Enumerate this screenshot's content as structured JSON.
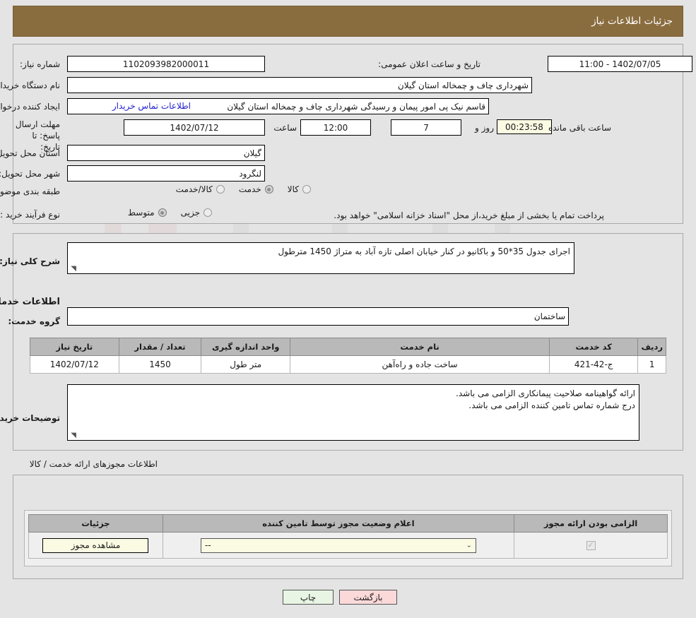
{
  "header": {
    "title": "جزئیات اطلاعات نیاز",
    "bar_color": "#8a6d3f"
  },
  "top_section": {
    "labels": {
      "need_number": "شماره نیاز:",
      "buyer_org": "نام دستگاه خریدار:",
      "requester": "ایجاد کننده درخواست:",
      "deadline": "مهلت ارسال پاسخ: تا تاریخ:",
      "province": "استان محل تحویل:",
      "city": "شهر محل تحویل:",
      "category": "طبقه بندی موضوعی:",
      "purchase_type": "نوع فرآیند خرید :",
      "public_announce": "تاریخ و ساعت اعلان عمومی:",
      "hour": "ساعت",
      "day_and": "روز و",
      "hours_left": "ساعت باقی مانده"
    },
    "values": {
      "need_number": "1102093982000011",
      "public_announce": "1402/07/05 - 11:00",
      "buyer_org": "شهرداری چاف و چمخاله استان گیلان",
      "requester": "قاسم نیک پی امور پیمان و رسیدگی شهرداری چاف و چمخاله استان گیلان",
      "contact_link": "اطلاعات تماس خریدار",
      "deadline_date": "1402/07/12",
      "deadline_hour": "12:00",
      "days_left": "7",
      "time_left": "00:23:58",
      "province": "گیلان",
      "city": "لنگرود"
    },
    "category_options": [
      {
        "label": "کالا",
        "checked": false
      },
      {
        "label": "خدمت",
        "checked": true
      },
      {
        "label": "کالا/خدمت",
        "checked": false
      }
    ],
    "purchase_options": [
      {
        "label": "جزیی",
        "checked": false
      },
      {
        "label": "متوسط",
        "checked": true
      }
    ],
    "purchase_note": "پرداخت تمام یا بخشی از مبلغ خرید،از محل \"اسناد خزانه اسلامی\" خواهد بود."
  },
  "mid_section": {
    "labels": {
      "general_desc": "شرح کلی نیاز:",
      "services_info": "اطلاعات خدمات مورد نیاز",
      "service_group": "گروه خدمت:",
      "buyer_notes": "توضیحات خریدار:"
    },
    "values": {
      "general_desc": "اجرای جدول 35*50 و باکانیو در کنار خیابان اصلی تازه آباد به متراژ 1450 مترطول",
      "service_group": "ساختمان",
      "buyer_notes_line1": "ارائه گواهینامه صلاحیت پیمانکاری الزامی می باشد.",
      "buyer_notes_line2": "درج شماره تماس تامین کننده الزامی می باشد."
    },
    "service_table": {
      "headers": [
        "ردیف",
        "کد خدمت",
        "نام خدمت",
        "واحد اندازه گیری",
        "تعداد / مقدار",
        "تاریخ نیاز"
      ],
      "rows": [
        {
          "row_no": "1",
          "service_code": "ج-42-421",
          "service_name": "ساخت جاده و راه‌آهن",
          "unit": "متر طول",
          "quantity": "1450",
          "need_date": "1402/07/12"
        }
      ]
    }
  },
  "bottom_section": {
    "title": "اطلاعات مجوزهای ارائه خدمت / کالا",
    "license_table": {
      "headers": [
        "الزامی بودن ارائه مجوز",
        "اعلام وضعیت مجوز توسط تامین کننده",
        "جزئیات"
      ],
      "rows": [
        {
          "required_checked": true,
          "status_value": "--",
          "details_button": "مشاهده مجوز"
        }
      ]
    }
  },
  "footer": {
    "print_button": "چاپ",
    "back_button": "بازگشت"
  },
  "colors": {
    "header_brown": "#8a6d3f",
    "page_bg": "#e4e4e4",
    "link_blue": "#2222cc",
    "ivory_field": "#fbfbe4",
    "print_green": "#e8f5e4",
    "back_pink": "#fcd9d9",
    "table_header_gray": "#b9b9b9"
  }
}
